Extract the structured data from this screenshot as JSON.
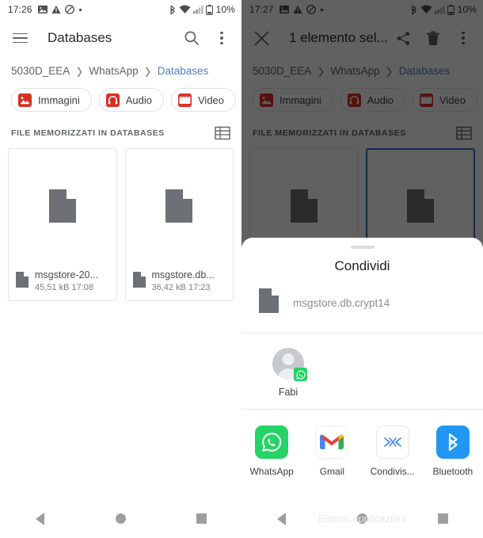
{
  "left": {
    "statusbar": {
      "time": "17:26",
      "icons": [
        "image-icon",
        "warning-icon",
        "do-not-disturb-icon",
        "dot-icon"
      ],
      "right_icons": [
        "bluetooth-icon",
        "wifi-icon",
        "signal-icon",
        "battery-icon"
      ],
      "battery": "10%"
    },
    "appbar": {
      "menu_icon": "hamburger-icon",
      "title": "Databases",
      "search_icon": "search-icon",
      "overflow_icon": "kebab-menu-icon"
    },
    "breadcrumb": [
      {
        "label": "5030D_EEA",
        "current": false
      },
      {
        "label": "WhatsApp",
        "current": false
      },
      {
        "label": "Databases",
        "current": true
      }
    ],
    "chips": [
      {
        "label": "Immagini",
        "icon": "images-icon"
      },
      {
        "label": "Audio",
        "icon": "headphones-icon"
      },
      {
        "label": "Video",
        "icon": "film-icon"
      },
      {
        "label": "",
        "icon": "documents-icon"
      }
    ],
    "section": {
      "title": "FILE MEMORIZZATI IN DATABASES",
      "view_toggle_icon": "list-view-icon"
    },
    "files": [
      {
        "name": "msgstore-20...",
        "size": "45,51 kB",
        "time": "17:08",
        "selected": false
      },
      {
        "name": "msgstore.db...",
        "size": "36,42 kB",
        "time": "17:23",
        "selected": false
      }
    ],
    "navbar": {
      "back": "back-icon",
      "home": "home-icon",
      "recents": "recents-icon",
      "hint": ""
    }
  },
  "right": {
    "statusbar": {
      "time": "17:27",
      "battery": "10%"
    },
    "appbar": {
      "close_icon": "close-icon",
      "title": "1 elemento sel...",
      "share_icon": "share-icon",
      "delete_icon": "trash-icon",
      "overflow_icon": "kebab-menu-icon"
    },
    "breadcrumb": [
      {
        "label": "5030D_EEA",
        "current": false
      },
      {
        "label": "WhatsApp",
        "current": false
      },
      {
        "label": "Databases",
        "current": true
      }
    ],
    "chips": [
      {
        "label": "Immagini",
        "icon": "images-icon"
      },
      {
        "label": "Audio",
        "icon": "headphones-icon"
      },
      {
        "label": "Video",
        "icon": "film-icon"
      },
      {
        "label": "",
        "icon": "documents-icon"
      }
    ],
    "section": {
      "title": "FILE MEMORIZZATI IN DATABASES",
      "view_toggle_icon": "list-view-icon"
    },
    "files": [
      {
        "name": "",
        "size": "",
        "time": "",
        "selected": false
      },
      {
        "name": "",
        "size": "",
        "time": "",
        "selected": true
      }
    ],
    "sheet": {
      "title": "Condividi",
      "file_name": "msgstore.db.crypt14",
      "file_icon": "document-icon",
      "contacts": [
        {
          "name": "Fabi",
          "app_badge": "whatsapp-icon"
        }
      ],
      "apps": [
        {
          "name": "WhatsApp",
          "icon": "whatsapp-icon"
        },
        {
          "name": "Gmail",
          "icon": "gmail-icon"
        },
        {
          "name": "Condivis...",
          "icon": "nearby-share-icon"
        },
        {
          "name": "Bluetooth",
          "icon": "bluetooth-icon"
        }
      ]
    },
    "navbar": {
      "back": "back-icon",
      "home": "home-icon",
      "recents": "recents-icon",
      "hint": "Elenco applicazioni"
    }
  },
  "colors": {
    "accent_blue": "#4f7ec4",
    "selected_border": "#2d6cc4",
    "chip_red": "#d93025",
    "whatsapp_green": "#25d366",
    "bluetooth_blue": "#2196f3"
  }
}
